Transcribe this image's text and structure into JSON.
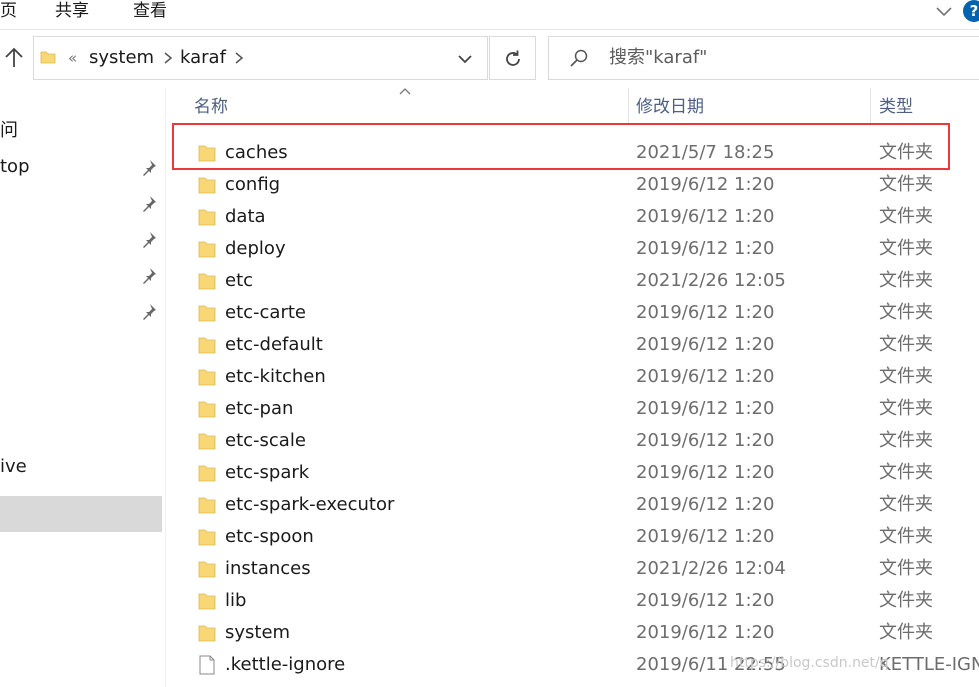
{
  "ribbon": {
    "tabs": [
      {
        "label": "页"
      },
      {
        "label": "共享"
      },
      {
        "label": "查看"
      }
    ]
  },
  "address": {
    "overflow": "«",
    "segments": [
      "system",
      "karaf"
    ]
  },
  "search": {
    "placeholder": "搜索\"karaf\""
  },
  "sidebar": {
    "items": [
      {
        "label": "问"
      },
      {
        "label": "top"
      },
      {
        "label": "ive"
      }
    ]
  },
  "columns": {
    "name": "名称",
    "date": "修改日期",
    "type": "类型"
  },
  "files": [
    {
      "name": "caches",
      "date": "2021/5/7 18:25",
      "type": "文件夹",
      "kind": "folder"
    },
    {
      "name": "config",
      "date": "2019/6/12 1:20",
      "type": "文件夹",
      "kind": "folder"
    },
    {
      "name": "data",
      "date": "2019/6/12 1:20",
      "type": "文件夹",
      "kind": "folder"
    },
    {
      "name": "deploy",
      "date": "2019/6/12 1:20",
      "type": "文件夹",
      "kind": "folder"
    },
    {
      "name": "etc",
      "date": "2021/2/26 12:05",
      "type": "文件夹",
      "kind": "folder"
    },
    {
      "name": "etc-carte",
      "date": "2019/6/12 1:20",
      "type": "文件夹",
      "kind": "folder"
    },
    {
      "name": "etc-default",
      "date": "2019/6/12 1:20",
      "type": "文件夹",
      "kind": "folder"
    },
    {
      "name": "etc-kitchen",
      "date": "2019/6/12 1:20",
      "type": "文件夹",
      "kind": "folder"
    },
    {
      "name": "etc-pan",
      "date": "2019/6/12 1:20",
      "type": "文件夹",
      "kind": "folder"
    },
    {
      "name": "etc-scale",
      "date": "2019/6/12 1:20",
      "type": "文件夹",
      "kind": "folder"
    },
    {
      "name": "etc-spark",
      "date": "2019/6/12 1:20",
      "type": "文件夹",
      "kind": "folder"
    },
    {
      "name": "etc-spark-executor",
      "date": "2019/6/12 1:20",
      "type": "文件夹",
      "kind": "folder"
    },
    {
      "name": "etc-spoon",
      "date": "2019/6/12 1:20",
      "type": "文件夹",
      "kind": "folder"
    },
    {
      "name": "instances",
      "date": "2021/2/26 12:04",
      "type": "文件夹",
      "kind": "folder"
    },
    {
      "name": "lib",
      "date": "2019/6/12 1:20",
      "type": "文件夹",
      "kind": "folder"
    },
    {
      "name": "system",
      "date": "2019/6/12 1:20",
      "type": "文件夹",
      "kind": "folder"
    },
    {
      "name": ".kettle-ignore",
      "date": "2019/6/11 22:55",
      "type": "KETTLE-IGN",
      "kind": "file"
    }
  ],
  "watermark": "https://blog.csdn.net/q",
  "colors": {
    "folder": "#f8d775",
    "highlight": "#e8393b",
    "selection": "#d9d9d9",
    "header_text": "#4d6082"
  }
}
